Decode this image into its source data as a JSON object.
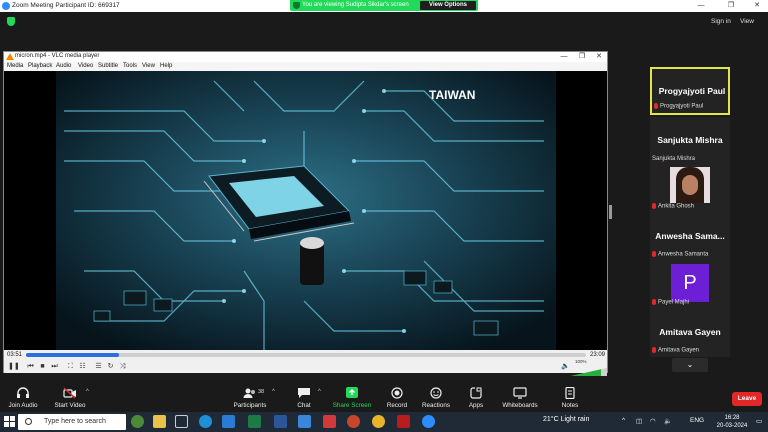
{
  "window": {
    "title": "Zoom Meeting Participant ID: 669317",
    "sign_in": "Sign in",
    "view": "View"
  },
  "banner": {
    "message": "You are viewing Sudipta Sikdar's screen",
    "view_options": "View Options"
  },
  "vlc": {
    "title": "micron.mp4 - VLC media player",
    "menu": [
      "Media",
      "Playback",
      "Audio",
      "Video",
      "Subtitle",
      "Tools",
      "View",
      "Help"
    ],
    "elapsed": "03:51",
    "total": "23:09",
    "progress": 0.166,
    "volume": "100%",
    "watermark": "TAIWAN"
  },
  "participants": [
    {
      "display": "Progyajyoti Paul",
      "label": "Progyajyoti Paul",
      "muted": true,
      "type": "name"
    },
    {
      "display": "Sanjukta Mishra",
      "label": "Sanjukta Mishra",
      "muted": false,
      "type": "name"
    },
    {
      "display": "",
      "label": "Ankita Ghosh",
      "muted": true,
      "type": "photo"
    },
    {
      "display": "Anwesha  Sama...",
      "label": "Anwesha Samanta",
      "muted": true,
      "type": "name"
    },
    {
      "display": "P",
      "label": "Payel Majhi",
      "muted": true,
      "type": "avatar"
    },
    {
      "display": "Amitava Gayen",
      "label": "Amitava Gayen",
      "muted": true,
      "type": "name"
    }
  ],
  "toolbar": {
    "join_audio": "Join Audio",
    "start_video": "Start Video",
    "participants": "Participants",
    "participants_count": "38",
    "chat": "Chat",
    "share_screen": "Share Screen",
    "record": "Record",
    "reactions": "Reactions",
    "apps": "Apps",
    "whiteboards": "Whiteboards",
    "notes": "Notes",
    "leave": "Leave"
  },
  "taskbar": {
    "search_placeholder": "Type here to search",
    "weather": "21°C  Light rain",
    "lang": "ENG",
    "time": "16:28",
    "date": "20-03-2024"
  },
  "colors": {
    "zoom_green": "#23d959",
    "highlight": "#e3e34a",
    "leave_red": "#e02828",
    "avatar_purple": "#6d1fd6",
    "vlc_seek": "#2d6ee0"
  }
}
